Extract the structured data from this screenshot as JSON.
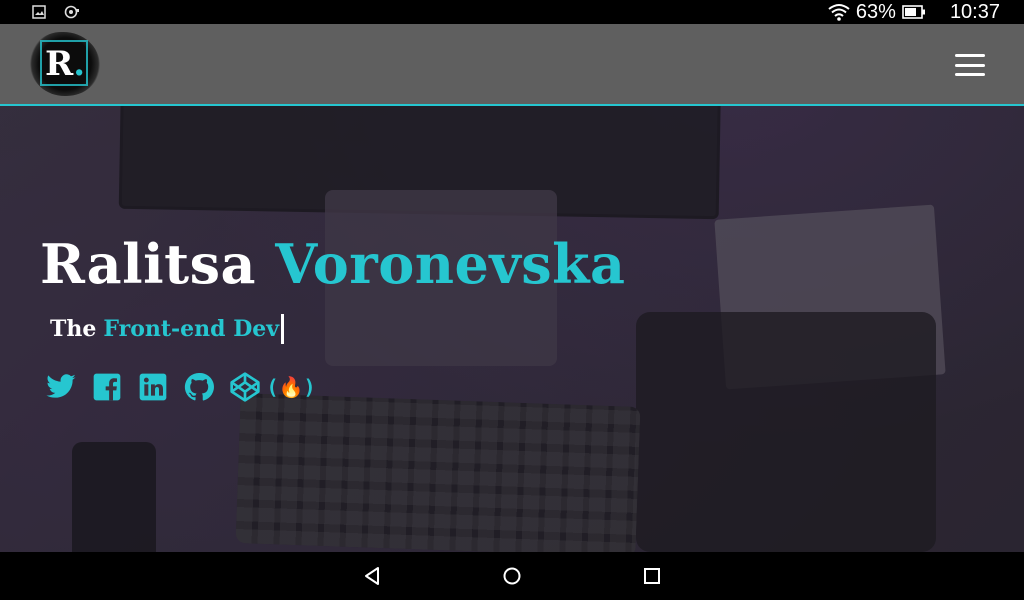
{
  "status_bar": {
    "battery_percent": "63%",
    "time": "10:37",
    "left_icons": [
      "image-notification-icon",
      "sync-notification-icon"
    ],
    "right_icons": [
      "wifi-icon",
      "battery-icon"
    ]
  },
  "navbar": {
    "logo_letter": "R",
    "logo_dot": ".",
    "menu_icon": "hamburger-menu-icon"
  },
  "hero": {
    "first_name": "Ralitsa",
    "last_name": "Voronevska",
    "tagline_lead": "The",
    "tagline_role": "Front-end Dev"
  },
  "social_links": [
    {
      "icon": "twitter-icon"
    },
    {
      "icon": "facebook-icon"
    },
    {
      "icon": "linkedin-icon"
    },
    {
      "icon": "github-icon"
    },
    {
      "icon": "codepen-icon"
    },
    {
      "icon": "freecodecamp-icon",
      "glyph": "(🔥)"
    }
  ],
  "colors": {
    "accent": "#26c6d0",
    "navbar": "#5f5f5f",
    "text": "#ffffff"
  },
  "android_nav": [
    "back-icon",
    "home-icon",
    "recents-icon"
  ]
}
